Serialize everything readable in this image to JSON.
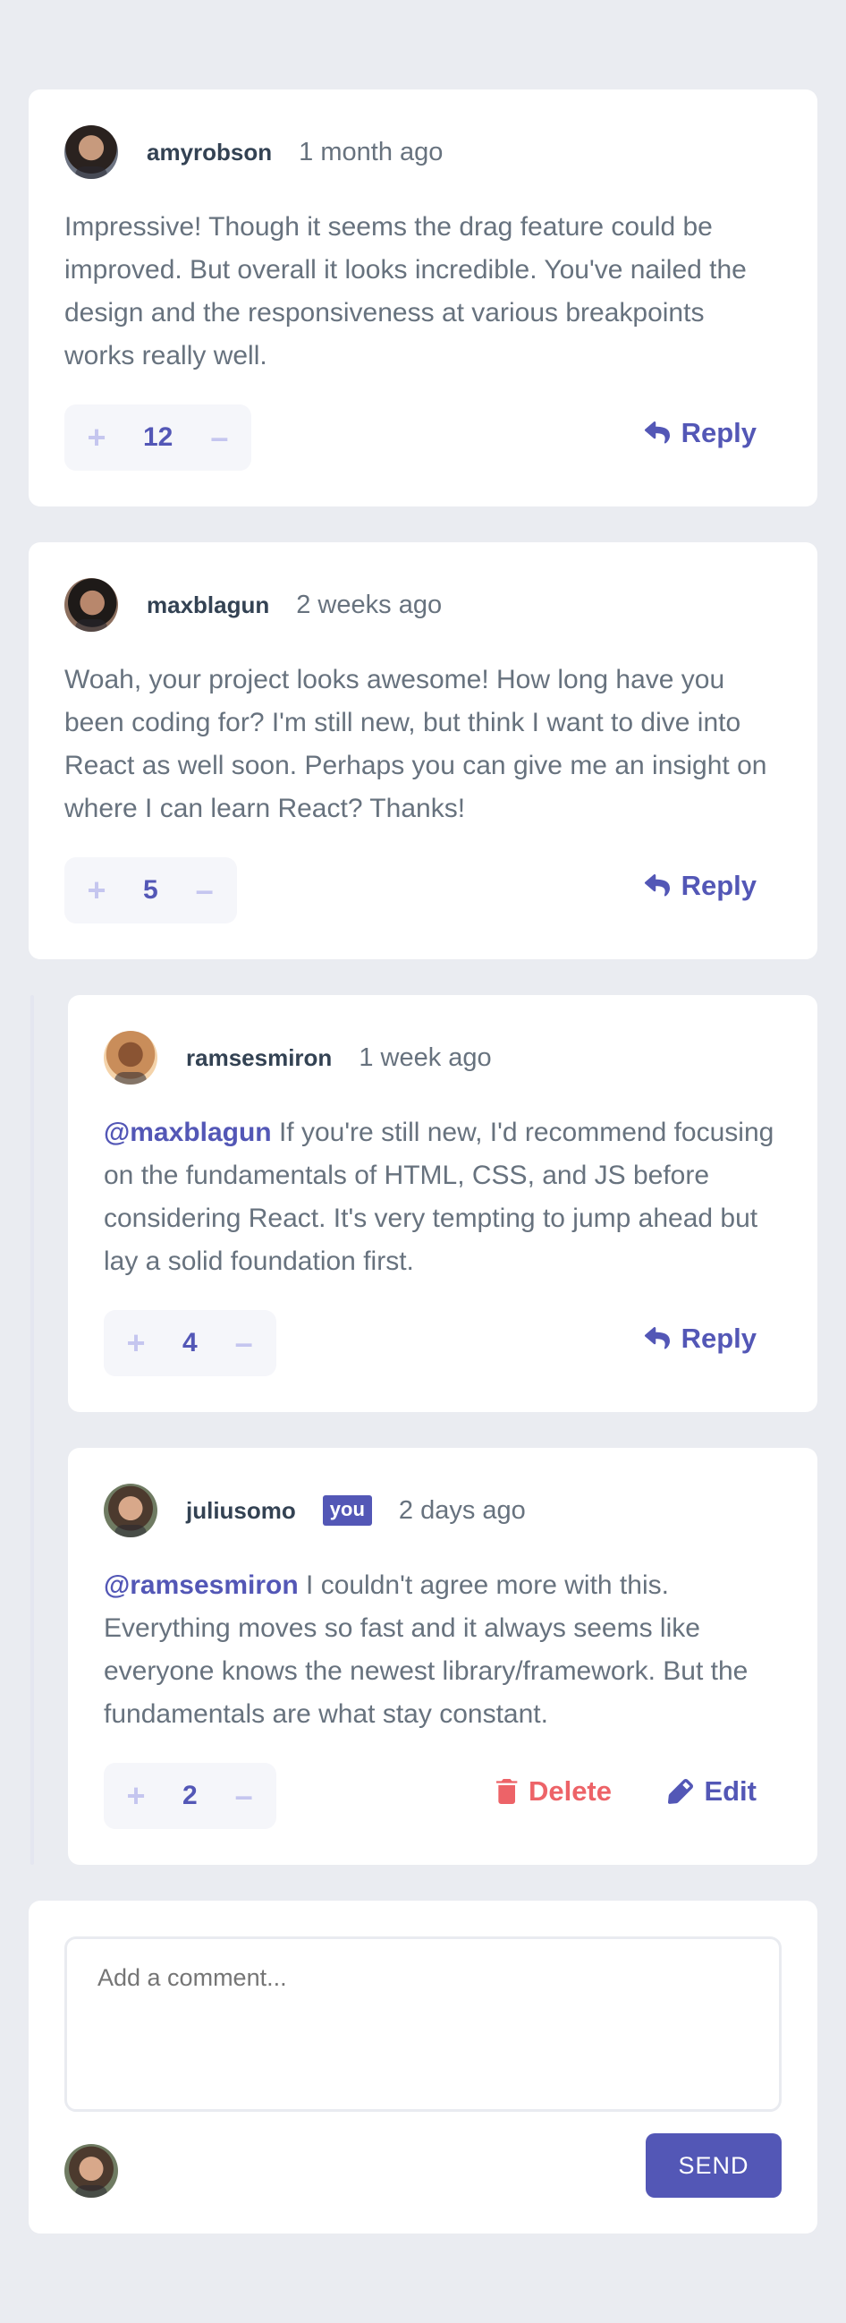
{
  "comments": [
    {
      "username": "amyrobson",
      "time": "1 month ago",
      "content": "Impressive! Though it seems the drag feature could be improved. But overall it looks incredible. You've nailed the design and the responsiveness at various breakpoints works really well.",
      "score": "12",
      "avatar_icon": "avatar-amyrobson"
    },
    {
      "username": "maxblagun",
      "time": "2 weeks ago",
      "content": "Woah, your project looks awesome! How long have you been coding for? I'm still new, but think I want to dive into React as well soon. Perhaps you can give me an insight on where I can learn React? Thanks!",
      "score": "5",
      "avatar_icon": "avatar-maxblagun"
    }
  ],
  "replies": [
    {
      "username": "ramsesmiron",
      "time": "1 week ago",
      "mention": "@maxblagun",
      "content": " If you're still new, I'd recommend focusing on the fundamentals of HTML, CSS, and JS before considering React. It's very tempting to jump ahead but lay a solid foundation first.",
      "score": "4",
      "avatar_icon": "avatar-ramsesmiron"
    },
    {
      "username": "juliusomo",
      "badge": "you",
      "time": "2 days ago",
      "mention": "@ramsesmiron",
      "content": " I couldn't agree more with this. Everything moves so fast and it always seems like everyone knows the newest library/framework. But the fundamentals are what stay constant.",
      "score": "2",
      "avatar_icon": "avatar-juliusomo"
    }
  ],
  "labels": {
    "reply": "Reply",
    "delete": "Delete",
    "edit": "Edit",
    "plus": "+",
    "minus": "–"
  },
  "composer": {
    "placeholder": "Add a comment...",
    "send_label": "SEND"
  },
  "colors": {
    "accent": "#5357b6",
    "danger": "#ed6368",
    "background": "#eaecf1",
    "vote_light": "#c5c6ef"
  }
}
